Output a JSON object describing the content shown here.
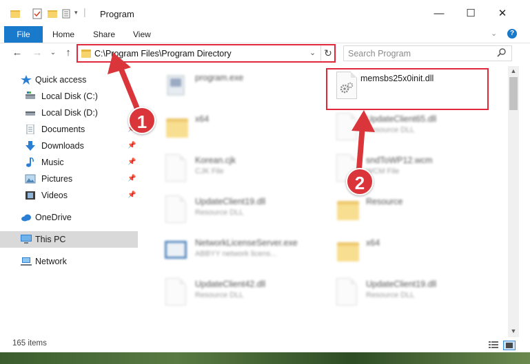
{
  "window": {
    "title": "Program",
    "controls": {
      "minimize": "—",
      "maximize": "☐",
      "close": "✕"
    }
  },
  "ribbon": {
    "file": "File",
    "tabs": [
      "Home",
      "Share",
      "View"
    ],
    "help": "?"
  },
  "address": {
    "path": "C:\\Program Files\\Program Directory"
  },
  "search": {
    "placeholder": "Search Program"
  },
  "sidebar": {
    "items": [
      {
        "label": "Quick access",
        "icon": "star-icon",
        "pinned": false
      },
      {
        "label": "Local Disk (C:)",
        "icon": "drive-icon",
        "pinned": false
      },
      {
        "label": "Local Disk (D:)",
        "icon": "drive-icon",
        "pinned": false
      },
      {
        "label": "Documents",
        "icon": "documents-icon",
        "pinned": true
      },
      {
        "label": "Downloads",
        "icon": "download-icon",
        "pinned": true
      },
      {
        "label": "Music",
        "icon": "music-icon",
        "pinned": true
      },
      {
        "label": "Pictures",
        "icon": "pictures-icon",
        "pinned": true
      },
      {
        "label": "Videos",
        "icon": "videos-icon",
        "pinned": true
      },
      {
        "label": "OneDrive",
        "icon": "cloud-icon",
        "pinned": false
      },
      {
        "label": "This PC",
        "icon": "computer-icon",
        "pinned": false,
        "selected": true
      },
      {
        "label": "Network",
        "icon": "network-icon",
        "pinned": false
      }
    ]
  },
  "files": [
    {
      "name": "program.exe",
      "sub": "",
      "icon": "exe-icon"
    },
    {
      "name": "memsbs25x0init.dll",
      "sub": "",
      "icon": "dll-icon"
    },
    {
      "name": "x64",
      "sub": "",
      "icon": "folder-icon"
    },
    {
      "name": "UpdateClient65.dll",
      "sub": "Resource DLL",
      "icon": "dll-icon"
    },
    {
      "name": "Korean.cjk",
      "sub": "CJK File",
      "icon": "file-icon"
    },
    {
      "name": "sndToWP12.wcm",
      "sub": "WCM File",
      "icon": "file-icon"
    },
    {
      "name": "UpdateClient19.dll",
      "sub": "Resource DLL",
      "icon": "dll-icon"
    },
    {
      "name": "Resource",
      "sub": "",
      "icon": "folder-icon"
    },
    {
      "name": "NetworkLicenseServer.exe",
      "sub": "ABBYY network licens...",
      "icon": "exe-icon"
    },
    {
      "name": "x64",
      "sub": "",
      "icon": "folder-icon"
    },
    {
      "name": "UpdateClient42.dll",
      "sub": "Resource DLL",
      "icon": "dll-icon"
    },
    {
      "name": "UpdateClient19.dll",
      "sub": "Resource DLL",
      "icon": "dll-icon"
    }
  ],
  "status": {
    "count": "165 items"
  },
  "annotations": {
    "step1": "1",
    "step2": "2",
    "color": "#d9353a"
  },
  "colors": {
    "accent": "#1979ca",
    "highlight": "#e0283a"
  }
}
